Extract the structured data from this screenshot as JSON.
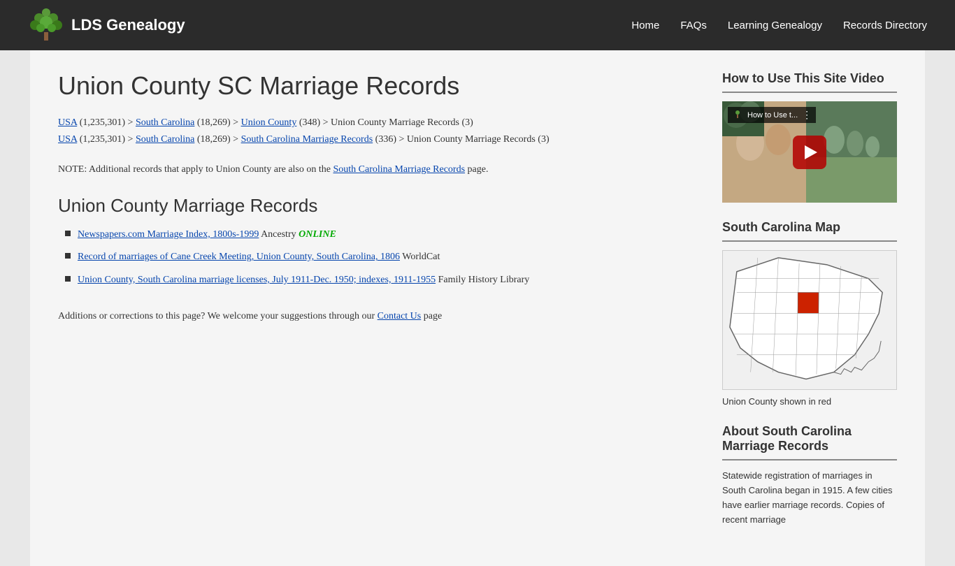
{
  "header": {
    "logo_text": "LDS Genealogy",
    "nav": {
      "home": "Home",
      "faqs": "FAQs",
      "learning": "Learning Genealogy",
      "records": "Records Directory"
    }
  },
  "page": {
    "title": "Union County SC Marriage Records",
    "breadcrumbs": [
      {
        "line": 1,
        "parts": [
          {
            "text": "USA",
            "link": true
          },
          {
            "text": " (1,235,301) > ",
            "link": false
          },
          {
            "text": "South Carolina",
            "link": true
          },
          {
            "text": " (18,269) > ",
            "link": false
          },
          {
            "text": "Union County",
            "link": true
          },
          {
            "text": " (348) > Union County Marriage Records (3)",
            "link": false
          }
        ]
      },
      {
        "line": 2,
        "parts": [
          {
            "text": "USA",
            "link": true
          },
          {
            "text": " (1,235,301) > ",
            "link": false
          },
          {
            "text": "South Carolina",
            "link": true
          },
          {
            "text": " (18,269) > ",
            "link": false
          },
          {
            "text": "South Carolina Marriage Records",
            "link": true
          },
          {
            "text": " (336) > Union County Marriage Records (3)",
            "link": false
          }
        ]
      }
    ],
    "note": "NOTE: Additional records that apply to Union County are also on the",
    "note_link": "South Carolina Marriage Records",
    "note_suffix": " page.",
    "section_title": "Union County Marriage Records",
    "records": [
      {
        "title": "Newspapers.com Marriage Index, 1800s-1999",
        "source": "Ancestry",
        "badge": "ONLINE",
        "has_badge": true
      },
      {
        "title": "Record of marriages of Cane Creek Meeting, Union County, South Carolina, 1806",
        "source": "WorldCat",
        "has_badge": false
      },
      {
        "title": "Union County, South Carolina marriage licenses, July 1911-Dec. 1950; indexes, 1911-1955",
        "source": "Family History Library",
        "has_badge": false
      }
    ],
    "additions_text": "Additions or corrections to this page? We welcome your suggestions through our",
    "contact_link": "Contact Us",
    "additions_suffix": " page"
  },
  "sidebar": {
    "video_section_title": "How to Use This Site Video",
    "video_title": "How to Use t...",
    "map_section_title": "South Carolina Map",
    "map_caption": "Union County shown in red",
    "about_section_title": "About South Carolina Marriage Records",
    "about_text": "Statewide registration of marriages in South Carolina began in 1915. A few cities have earlier marriage records. Copies of recent marriage"
  }
}
